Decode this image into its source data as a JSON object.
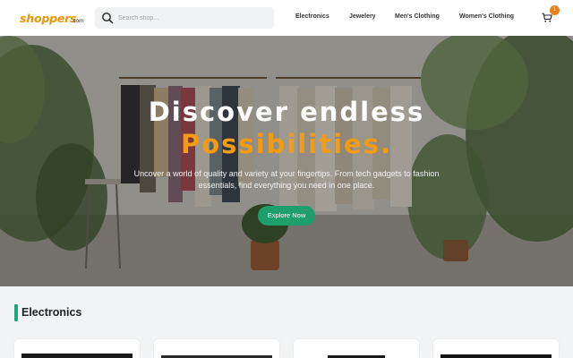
{
  "header": {
    "logo_text": "shoppers",
    "logo_suffix": ".com",
    "search": {
      "placeholder": "Search shop..."
    },
    "nav": [
      "Electronics",
      "Jewelery",
      "Men's Clothing",
      "Women's Clothing"
    ],
    "cart_count": "1",
    "icons": {
      "search": "search-icon",
      "cart": "cart-icon"
    },
    "colors": {
      "brand": "#e8960c",
      "badge": "#e8821e"
    }
  },
  "hero": {
    "title_line1": "Discover endless",
    "title_line2": "Possibilities.",
    "subtitle": "Uncover a world of quality and variety at your fingertips. From tech gadgets to fashion essentials, find everything you need in one place.",
    "cta_label": "Explore Now",
    "colors": {
      "accent": "#f39c12",
      "cta": "#1e9e6a"
    }
  },
  "section": {
    "title": "Electronics",
    "accent_color": "#1ea97c"
  }
}
